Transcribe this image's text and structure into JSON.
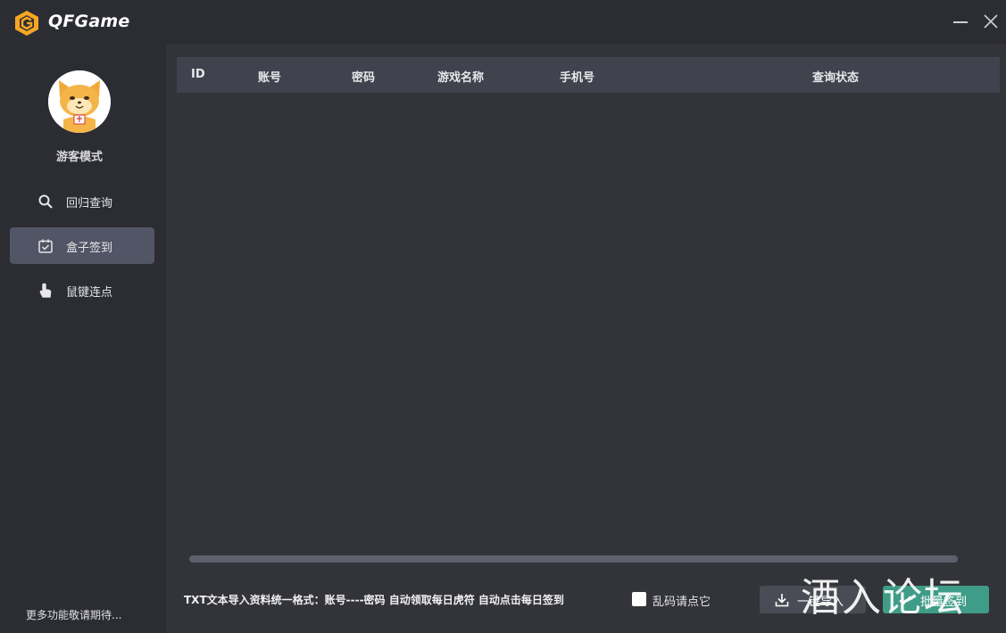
{
  "app": {
    "title": "QFGame"
  },
  "sidebar": {
    "user_label": "游客模式",
    "items": [
      {
        "label": "回归查询",
        "icon": "search-icon",
        "active": false
      },
      {
        "label": "盒子签到",
        "icon": "calendar-check-icon",
        "active": true
      },
      {
        "label": "鼠键连点",
        "icon": "pointer-hand-icon",
        "active": false
      }
    ],
    "more_label": "更多功能敬请期待..."
  },
  "table": {
    "columns": [
      "ID",
      "账号",
      "密码",
      "游戏名称",
      "手机号",
      "查询状态"
    ],
    "rows": []
  },
  "footer": {
    "instructions": "TXT文本导入资料统一格式：账号----密码  自动领取每日虎符  自动点击每日签到",
    "checkbox_label": "乱码请点它",
    "import_button": "一键导入",
    "signin_button": "批量签到"
  },
  "watermark": "酒入论坛",
  "colors": {
    "background": "#2b2d33",
    "content": "#333439",
    "header": "#40424d",
    "active_nav": "#525565",
    "accent_green": "#3f9c88",
    "logo_orange": "#f5a623"
  }
}
